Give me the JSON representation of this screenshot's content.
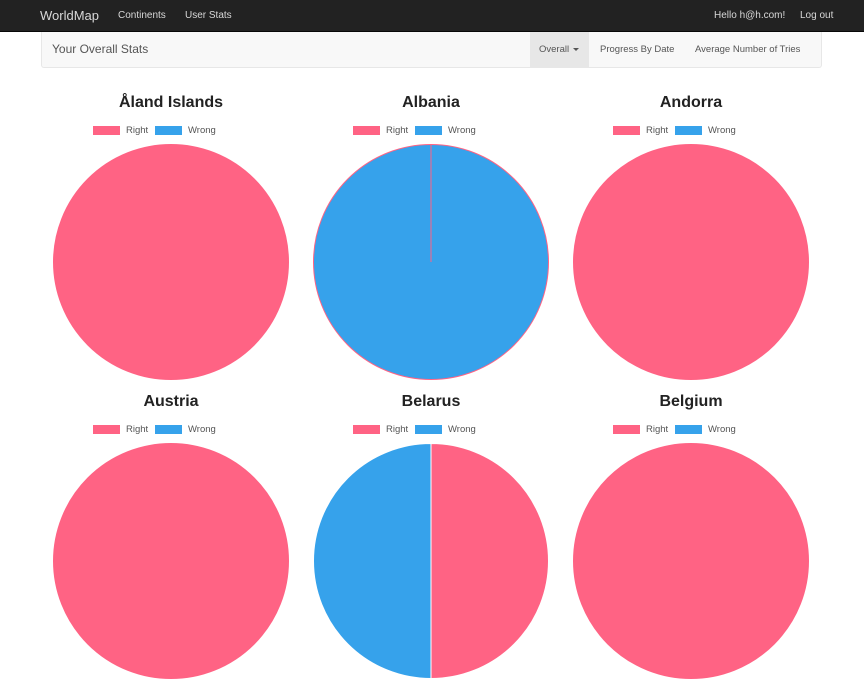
{
  "navbar": {
    "brand": "WorldMap",
    "links": [
      "Continents",
      "User Stats"
    ],
    "user_greeting": "Hello h@h.com!",
    "logout": "Log out"
  },
  "stats_bar": {
    "title": "Your Overall Stats",
    "tabs": [
      "Overall",
      "Progress By Date",
      "Average Number of Tries"
    ],
    "active_tab": "Overall"
  },
  "legend": {
    "right_label": "Right",
    "wrong_label": "Wrong"
  },
  "colors": {
    "right": "#ff6384",
    "wrong": "#36a2eb",
    "navbar_bg": "#222222"
  },
  "chart_data": [
    {
      "type": "pie",
      "title": "Åland Islands",
      "labels": [
        "Right",
        "Wrong"
      ],
      "values": [
        1,
        0
      ]
    },
    {
      "type": "pie",
      "title": "Albania",
      "labels": [
        "Right",
        "Wrong"
      ],
      "values": [
        0,
        1
      ]
    },
    {
      "type": "pie",
      "title": "Andorra",
      "labels": [
        "Right",
        "Wrong"
      ],
      "values": [
        1,
        0
      ]
    },
    {
      "type": "pie",
      "title": "Austria",
      "labels": [
        "Right",
        "Wrong"
      ],
      "values": [
        1,
        0
      ]
    },
    {
      "type": "pie",
      "title": "Belarus",
      "labels": [
        "Right",
        "Wrong"
      ],
      "values": [
        1,
        1
      ]
    },
    {
      "type": "pie",
      "title": "Belgium",
      "labels": [
        "Right",
        "Wrong"
      ],
      "values": [
        1,
        0
      ]
    }
  ]
}
